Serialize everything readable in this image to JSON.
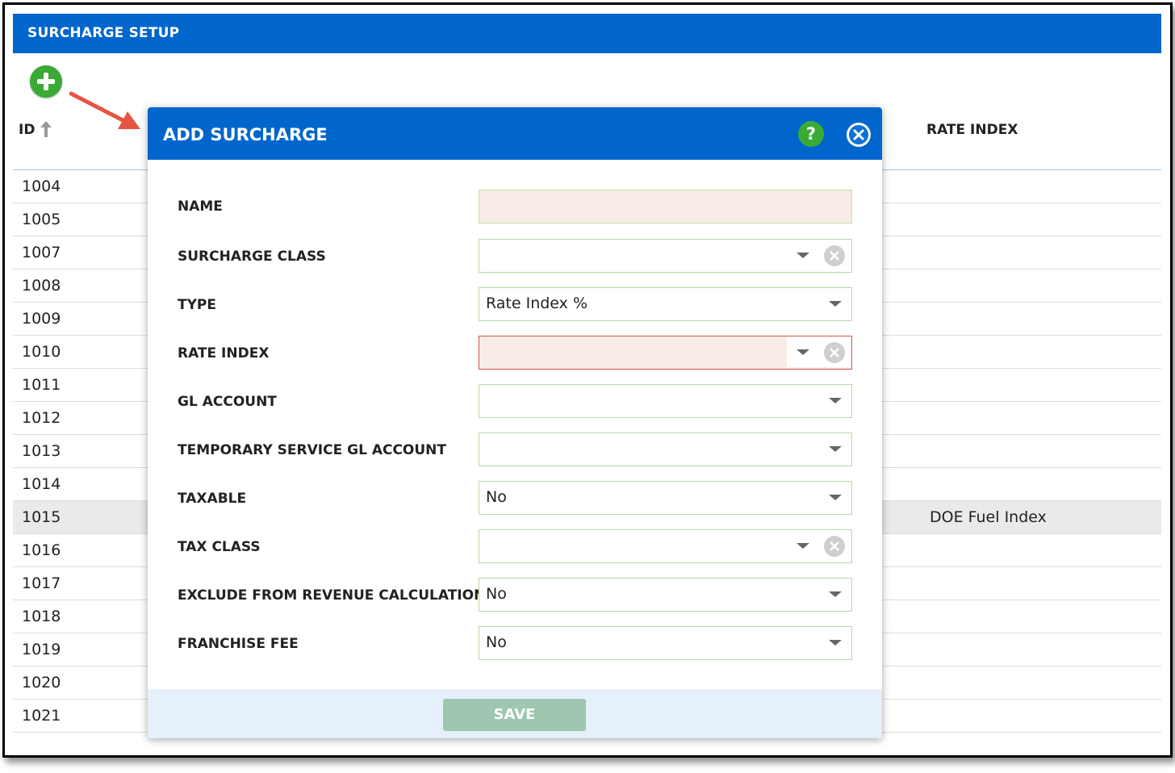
{
  "app": {
    "title": "SURCHARGE SETUP"
  },
  "table": {
    "columns": {
      "id": "ID",
      "rate_index": "RATE INDEX"
    },
    "rows": [
      {
        "id": "1004",
        "rate_index": ""
      },
      {
        "id": "1005",
        "rate_index": ""
      },
      {
        "id": "1007",
        "rate_index": ""
      },
      {
        "id": "1008",
        "rate_index": ""
      },
      {
        "id": "1009",
        "rate_index": ""
      },
      {
        "id": "1010",
        "rate_index": ""
      },
      {
        "id": "1011",
        "rate_index": ""
      },
      {
        "id": "1012",
        "rate_index": ""
      },
      {
        "id": "1013",
        "rate_index": ""
      },
      {
        "id": "1014",
        "rate_index": ""
      },
      {
        "id": "1015",
        "rate_index": "DOE Fuel Index",
        "selected": true
      },
      {
        "id": "1016",
        "rate_index": ""
      },
      {
        "id": "1017",
        "rate_index": ""
      },
      {
        "id": "1018",
        "rate_index": ""
      },
      {
        "id": "1019",
        "rate_index": ""
      },
      {
        "id": "1020",
        "rate_index": ""
      },
      {
        "id": "1021",
        "rate_index": ""
      }
    ],
    "sort_icon": "arrow-up-icon"
  },
  "toolbar": {
    "add_icon": "plus-circle-icon",
    "annotation": "red-arrow-icon"
  },
  "dialog": {
    "title": "ADD SURCHARGE",
    "help_label": "?",
    "help_icon": "help-icon",
    "close_icon": "close-icon",
    "fields": {
      "name": {
        "label": "NAME",
        "value": ""
      },
      "surcharge_class": {
        "label": "SURCHARGE CLASS",
        "value": ""
      },
      "type": {
        "label": "TYPE",
        "value": "Rate Index %"
      },
      "rate_index": {
        "label": "RATE INDEX",
        "value": ""
      },
      "gl_account": {
        "label": "GL ACCOUNT",
        "value": ""
      },
      "temp_gl_account": {
        "label": "TEMPORARY SERVICE GL ACCOUNT",
        "value": ""
      },
      "taxable": {
        "label": "TAXABLE",
        "value": "No"
      },
      "tax_class": {
        "label": "TAX CLASS",
        "value": ""
      },
      "exclude_revenue": {
        "label": "EXCLUDE FROM REVENUE CALCULATION",
        "value": "No"
      },
      "franchise_fee": {
        "label": "FRANCHISE FEE",
        "value": "No"
      }
    },
    "save_label": "SAVE"
  },
  "colors": {
    "header_blue": "#0066cc",
    "add_green": "#3aaa35",
    "error_bg": "#f8ece6",
    "error_border": "#d9534f",
    "save_disabled": "#9fc6ae"
  }
}
